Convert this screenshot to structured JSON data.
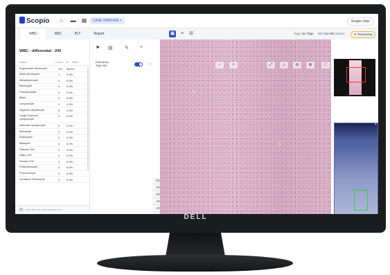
{
  "app": {
    "logo": "Scopio",
    "case_chip": "CASE 00001436  ×",
    "user": "Scopio User"
  },
  "tabs": [
    "WBC",
    "RBC",
    "PLT",
    "Report"
  ],
  "meta": {
    "tags_label": "Tags:",
    "tags_value": "No Tags",
    "bm_label": "BM:",
    "bm_value": "No Info",
    "status_label": "Status:",
    "status_value": "Reviewing"
  },
  "wbc": {
    "title": "WBC - differential - 200",
    "columns": [
      "Name",
      "Count",
      "%",
      "Abs#"
    ],
    "rows": [
      {
        "name": "Segmented Neutrophil",
        "count": "197",
        "pct": "98.5%"
      },
      {
        "name": "Band Neutrophil",
        "count": "1",
        "pct": "0.5%"
      },
      {
        "name": "Metamyelocyte",
        "count": "0",
        "pct": "0.0%"
      },
      {
        "name": "Myelocyte",
        "count": "0",
        "pct": "0.0%"
      },
      {
        "name": "Promyelocyte",
        "count": "0",
        "pct": "0.0%"
      },
      {
        "name": "Blast",
        "count": "0",
        "pct": "0.0%"
      },
      {
        "name": "Lymphocyte",
        "count": "2",
        "pct": "1.0%"
      },
      {
        "name": "Atypical Lymphocyte",
        "count": "0",
        "pct": "0.0%"
      },
      {
        "name": "Large Granular Lymphocyte",
        "count": "0",
        "pct": "0.0%",
        "tall": true
      },
      {
        "name": "Aberrant Lymphocyte",
        "count": "0",
        "pct": "0.0%"
      },
      {
        "name": "Monocyte",
        "count": "0",
        "pct": "0.0%"
      },
      {
        "name": "Eosinophil",
        "count": "0",
        "pct": "0.0%"
      },
      {
        "name": "Basophil",
        "count": "0",
        "pct": "0.0%"
      },
      {
        "name": "Plasma Cell",
        "count": "0",
        "pct": "0.0%"
      },
      {
        "name": "Hairy Cell",
        "count": "0",
        "pct": "0.0%"
      },
      {
        "name": "Sezary Cell",
        "count": "0",
        "pct": "0.0%"
      },
      {
        "name": "Prolymphocyte",
        "count": "0",
        "pct": "0.0%"
      },
      {
        "name": "Promonocyte",
        "count": "0",
        "pct": "0.0%"
      },
      {
        "name": "Immature Eosinophil",
        "count": "0",
        "pct": "0.0%"
      }
    ],
    "comment_placeholder": "Click here to add comment (or..."
  },
  "tools": {
    "layer_label_1": "Detections",
    "layer_label_2": "Total 200"
  },
  "zoom_levels": [
    "100x",
    "80x",
    "60x",
    "40x",
    "20x",
    "10x",
    "4x"
  ],
  "monitor_brand": "DELL"
}
